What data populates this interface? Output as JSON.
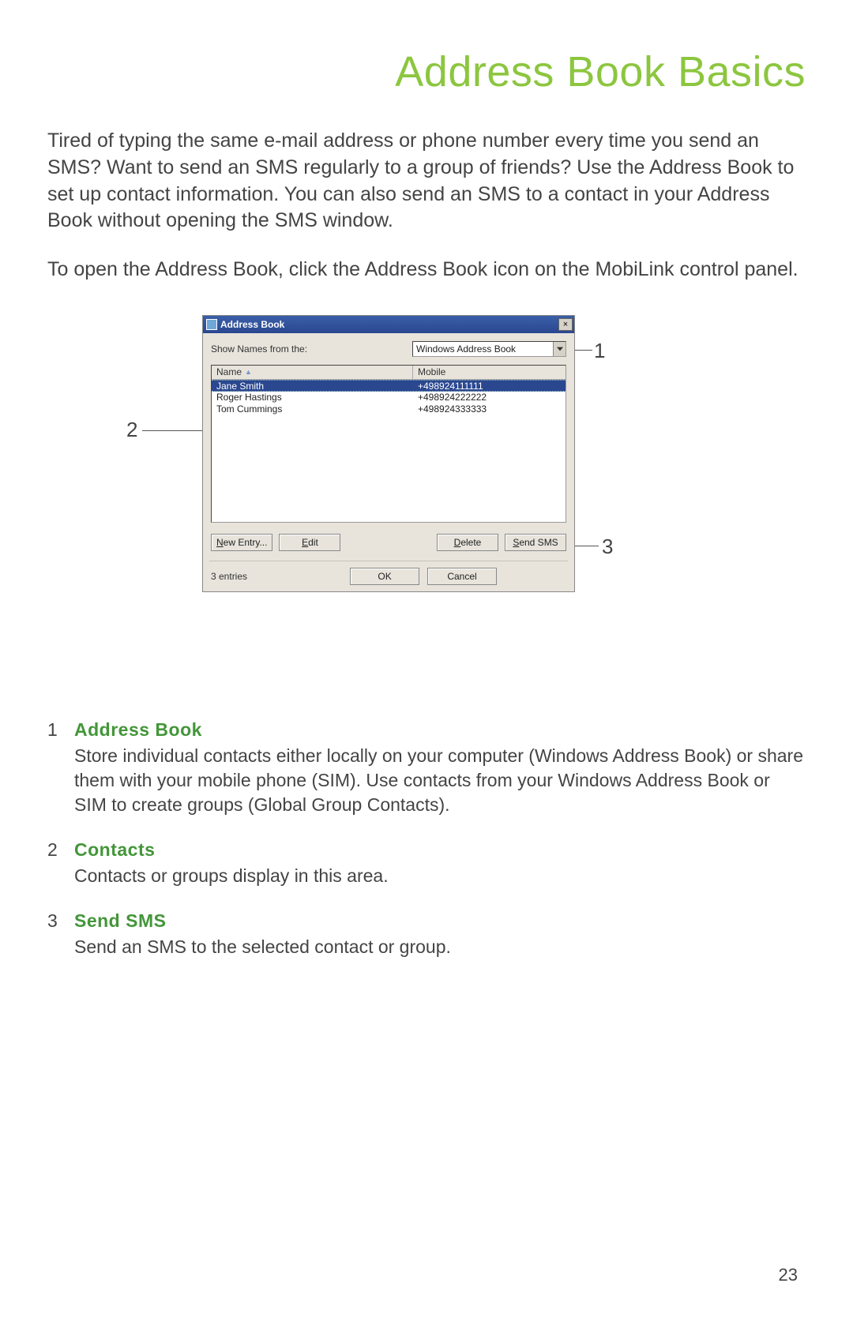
{
  "title": "Address Book Basics",
  "intro": "Tired of typing the same e-mail address or phone number every time you send an SMS? Want to send an SMS regularly to a group of friends? Use the Address Book to set up contact information. You can also send an SMS to a contact in your Address Book without opening the SMS window.",
  "subintro": "To open the Address Book, click the Address Book icon on the MobiLink control panel.",
  "dialog": {
    "title": "Address Book",
    "close": "×",
    "show_label": "Show Names from the:",
    "dropdown_value": "Windows Address Book",
    "col_name": "Name",
    "col_mobile": "Mobile",
    "rows": [
      {
        "name": "Jane Smith",
        "mobile": "+498924111111"
      },
      {
        "name": "Roger Hastings",
        "mobile": "+498924222222"
      },
      {
        "name": "Tom Cummings",
        "mobile": "+498924333333"
      }
    ],
    "btn_new": "New Entry...",
    "btn_edit": "Edit",
    "btn_delete": "Delete",
    "btn_sendsms": "Send SMS",
    "entries": "3 entries",
    "btn_ok": "OK",
    "btn_cancel": "Cancel"
  },
  "callouts": {
    "c1": "1",
    "c2": "2",
    "c3": "3"
  },
  "legend": [
    {
      "num": "1",
      "head": "Address Book",
      "desc": "Store individual contacts either locally on your computer (Windows Address Book) or share them with your mobile phone (SIM). Use contacts from your Windows Address Book or SIM to create groups (Global Group Contacts)."
    },
    {
      "num": "2",
      "head": "Contacts",
      "desc": "Contacts or groups display in this area."
    },
    {
      "num": "3",
      "head": "Send SMS",
      "desc": "Send an SMS to the selected contact or group."
    }
  ],
  "page_number": "23"
}
